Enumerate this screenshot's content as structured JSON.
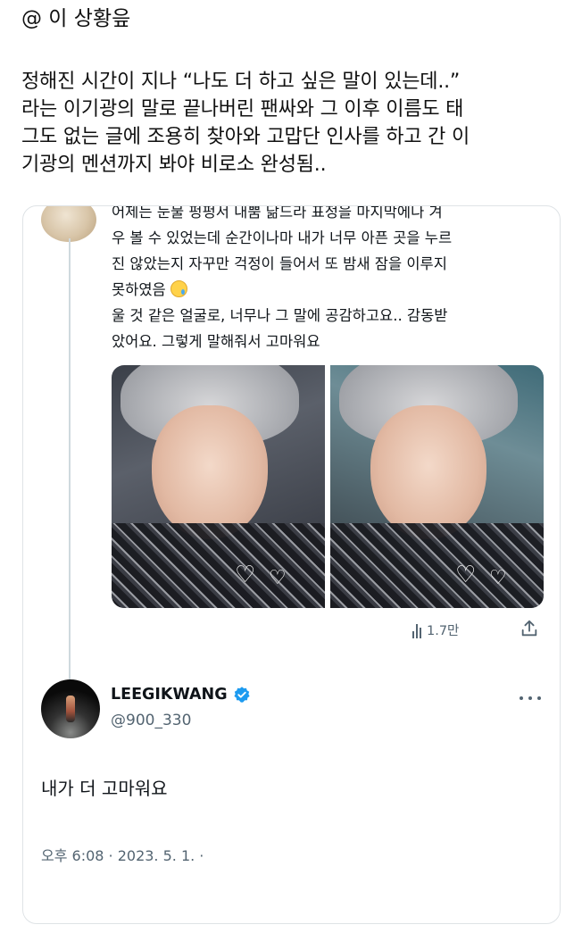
{
  "outer_post": {
    "header": "@ 이 상황읖",
    "body_lines": [
      "정해진 시간이 지나 “나도 더 하고 싶은 말이 있는데..”",
      "라는 이기광의 말로 끝나버린 팬싸와 그 이후 이름도 태",
      "그도 없는 글에 조용히 찾아와 고맙단 인사를 하고 간 이",
      "기광의 멘션까지 봐야 비로소 완성됨.."
    ]
  },
  "reply_tweet": {
    "text_lines": [
      "어제는 눈물 펑펑서 내뿜 닮드라 표정을 마지막에나 겨",
      "우 볼 수 있었는데 순간이나마 내가 너무 아픈 곳을 누르",
      "진 않았는지 자꾸만 걱정이 들어서 또 밤새 잠을 이루지",
      "못하였음",
      "울 것 같은 얼굴로, 너무나 그 말에 공감하고요.. 감동받",
      "았어요. 그렇게 말해줘서 고마워요"
    ],
    "emoji": "crying-face-emoji",
    "views": "1.7만"
  },
  "main_tweet": {
    "display_name": "LEEGIKWANG",
    "handle": "@900_330",
    "verified": true,
    "text": "내가 더 고마워요",
    "timestamp": "오후 6:08 · 2023. 5. 1. ·"
  },
  "icons": {
    "views": "bar-chart-icon",
    "share": "share-icon",
    "verified": "verified-badge-icon",
    "more": "more-dots-icon"
  },
  "colors": {
    "text_primary": "#0f1419",
    "text_secondary": "#536471",
    "verified_blue": "#1d9bf0",
    "border": "#dfe3e6"
  }
}
